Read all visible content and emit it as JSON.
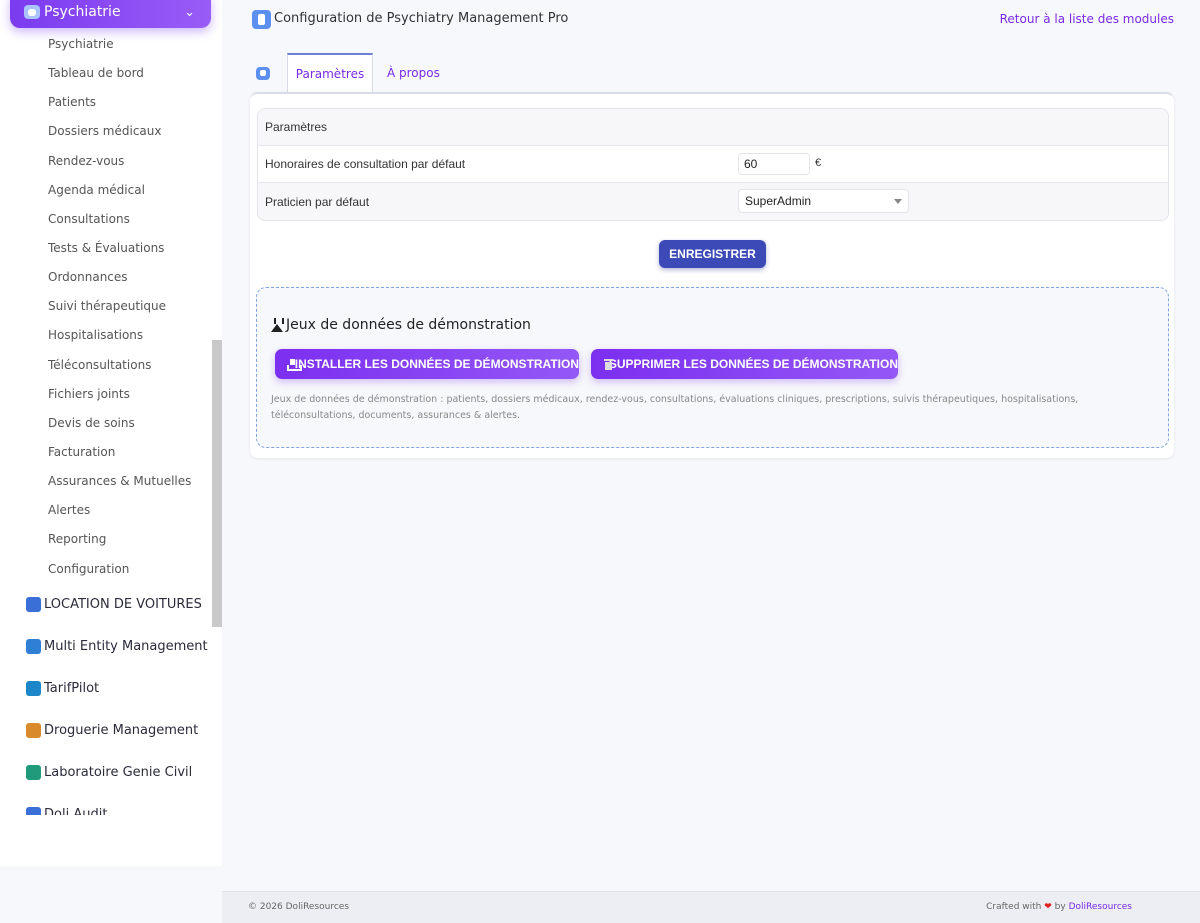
{
  "sidebar": {
    "active_module": "Psychiatrie",
    "items": [
      {
        "label": "Psychiatrie"
      },
      {
        "label": "Tableau de bord"
      },
      {
        "label": "Patients"
      },
      {
        "label": "Dossiers médicaux"
      },
      {
        "label": "Rendez-vous"
      },
      {
        "label": "Agenda médical"
      },
      {
        "label": "Consultations"
      },
      {
        "label": "Tests & Évaluations"
      },
      {
        "label": "Ordonnances"
      },
      {
        "label": "Suivi thérapeutique"
      },
      {
        "label": "Hospitalisations"
      },
      {
        "label": "Téléconsultations"
      },
      {
        "label": "Fichiers joints"
      },
      {
        "label": "Devis de soins"
      },
      {
        "label": "Facturation"
      },
      {
        "label": "Assurances & Mutuelles"
      },
      {
        "label": "Alertes"
      },
      {
        "label": "Reporting"
      },
      {
        "label": "Configuration"
      }
    ],
    "modules": [
      {
        "label": "LOCATION DE VOITURES",
        "color": "#3b6fd8"
      },
      {
        "label": "Multi Entity Management",
        "color": "#2f7fd6"
      },
      {
        "label": "TarifPilot",
        "color": "#1d86c8"
      },
      {
        "label": "Droguerie Management",
        "color": "#d98a2a"
      },
      {
        "label": "Laboratoire Genie Civil",
        "color": "#1f9a7a"
      },
      {
        "label": "Doli Audit",
        "color": "#3b6fd8"
      }
    ]
  },
  "header": {
    "title": "Configuration de Psychiatry Management Pro",
    "back_link": "Retour à la liste des modules"
  },
  "tabs": [
    {
      "label": "Paramètres",
      "active": true
    },
    {
      "label": "À propos",
      "active": false
    }
  ],
  "settings": {
    "section_title": "Paramètres",
    "fee_label": "Honoraires de consultation par défaut",
    "fee_value": "60",
    "currency": "€",
    "practitioner_label": "Praticien par défaut",
    "practitioner_value": "SuperAdmin",
    "save_label": "ENREGISTRER"
  },
  "demo": {
    "title": "Jeux de données de démonstration",
    "install_label": "INSTALLER LES DONNÉES DE DÉMONSTRATION",
    "delete_label": "SUPPRIMER LES DONNÉES DE DÉMONSTRATION",
    "description": "Jeux de données de démonstration : patients, dossiers médicaux, rendez-vous, consultations, évaluations cliniques, prescriptions, suivis thérapeutiques, hospitalisations, téléconsultations, documents, assurances & alertes."
  },
  "footer": {
    "copyright": "© 2026 DoliResources",
    "crafted_prefix": "Crafted with",
    "crafted_by": "by",
    "brand": "DoliResources"
  },
  "colors": {
    "accent": "#7a2ae8",
    "save_button": "#3c4ab7",
    "demo_border": "#7fa6e0"
  }
}
